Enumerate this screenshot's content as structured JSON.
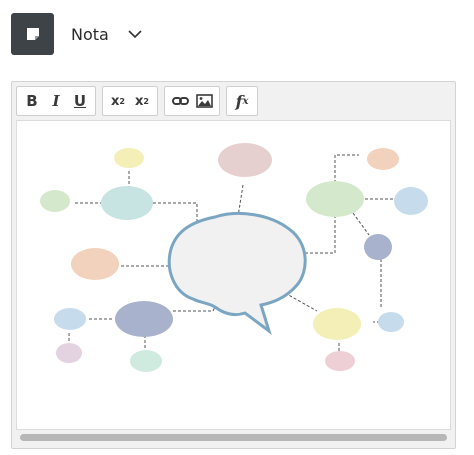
{
  "header": {
    "title": "Nota",
    "icon": "sticky-note-icon",
    "dropdown_icon": "chevron-down-icon"
  },
  "toolbar": {
    "bold_label": "B",
    "italic_label": "I",
    "underline_label": "U",
    "superscript_base": "x",
    "superscript_exp": "2",
    "subscript_base": "x",
    "subscript_idx": "2",
    "link_icon": "link-icon",
    "image_icon": "image-icon",
    "formula_base": "f",
    "formula_sub": "x"
  },
  "content": {
    "image": "mind-map-illustration",
    "colors": {
      "outline": "#7ba6c2",
      "bubble_fill": "#f1f1f1",
      "pink": "#e6cfcf",
      "yellow": "#f3efb6",
      "teal": "#c7e3e2",
      "green": "#d4e9cc",
      "peach": "#f3d2bd",
      "blue": "#c6dcec",
      "slate": "#a8b2cc",
      "lavender": "#e3d2df",
      "mint": "#cfeade",
      "rose": "#efcfd6"
    }
  }
}
